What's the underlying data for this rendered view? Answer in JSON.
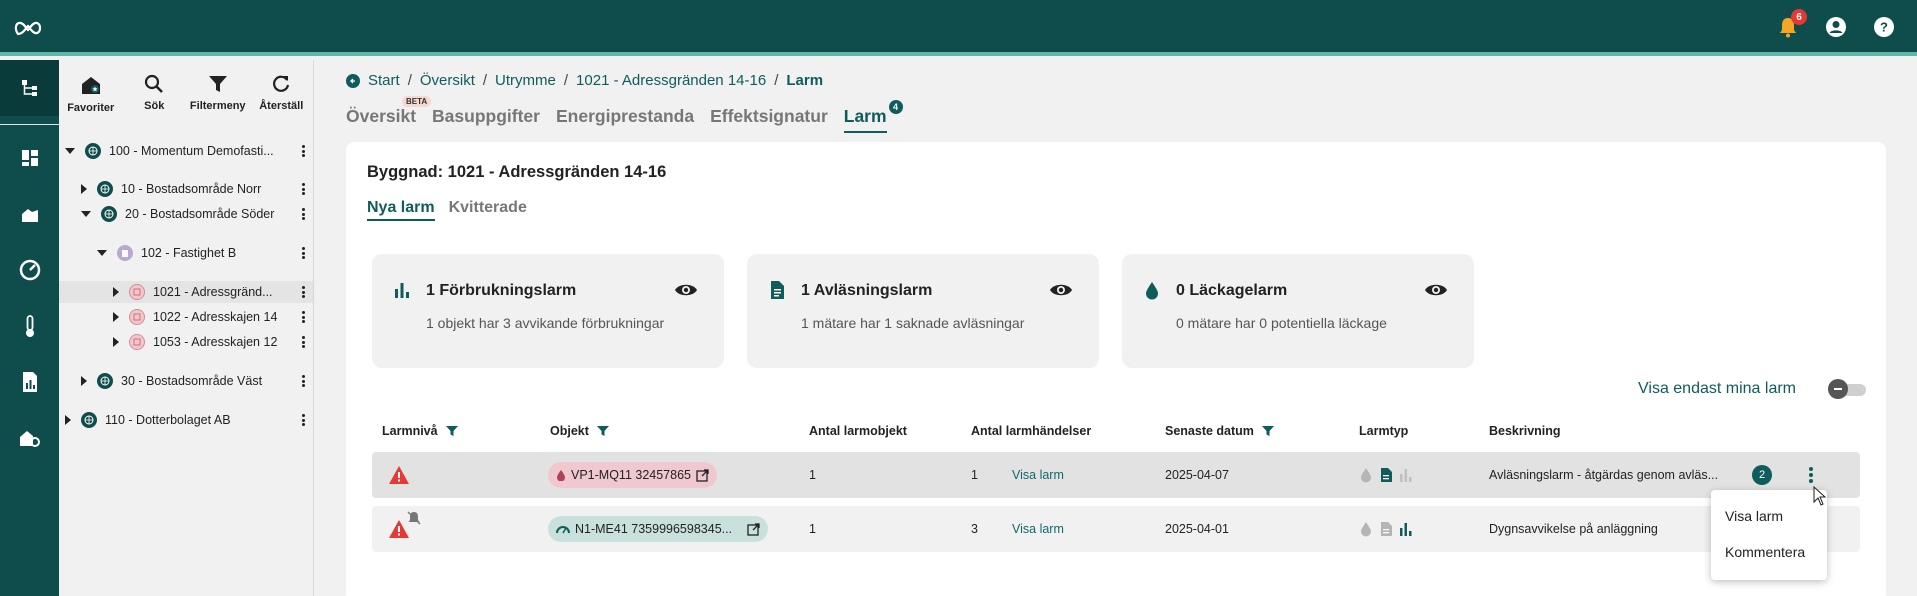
{
  "header": {
    "notification_count": "6"
  },
  "tree": {
    "tools": [
      {
        "label": "Favoriter",
        "icon": "favorite-house-icon"
      },
      {
        "label": "Sök",
        "icon": "search-icon"
      },
      {
        "label": "Filtermeny",
        "icon": "filter-icon"
      },
      {
        "label": "Återställ",
        "icon": "refresh-icon"
      }
    ],
    "nodes": [
      {
        "label": "100 - Momentum Demofasti...",
        "level": 0,
        "expanded": true,
        "type": "globe"
      },
      {
        "label": "10 - Bostadsområde Norr",
        "level": 1,
        "expanded": false,
        "type": "globe"
      },
      {
        "label": "20 - Bostadsområde Söder",
        "level": 1,
        "expanded": true,
        "type": "globe"
      },
      {
        "label": "102 - Fastighet B",
        "level": 2,
        "expanded": true,
        "type": "property"
      },
      {
        "label": "1021 - Adressgränd...",
        "level": 3,
        "expanded": false,
        "type": "building",
        "selected": true
      },
      {
        "label": "1022 - Adresskajen 14",
        "level": 3,
        "expanded": false,
        "type": "building"
      },
      {
        "label": "1053 - Adresskajen 12",
        "level": 3,
        "expanded": false,
        "type": "building"
      },
      {
        "label": "30 - Bostadsområde Väst",
        "level": 1,
        "expanded": false,
        "type": "globe"
      },
      {
        "label": "110 - Dotterbolaget AB",
        "level": 0,
        "expanded": false,
        "type": "globe"
      }
    ]
  },
  "breadcrumb": {
    "items": [
      "Start",
      "Översikt",
      "Utrymme",
      "1021 - Adressgränden 14-16"
    ],
    "current": "Larm"
  },
  "tabs": {
    "items": [
      "Översikt",
      "Basuppgifter",
      "Energiprestanda",
      "Effektsignatur",
      "Larm"
    ],
    "beta": "BETA",
    "larm_badge": "4"
  },
  "main": {
    "building_title": "Byggnad: 1021 - Adressgränden 14-16",
    "subtabs": [
      "Nya larm",
      "Kvitterade"
    ],
    "summary": [
      {
        "title": "1 Förbrukningslarm",
        "subtitle": "1 objekt har 3 avvikande förbrukningar"
      },
      {
        "title": "1 Avläsningslarm",
        "subtitle": "1 mätare har 1 saknade avläsningar"
      },
      {
        "title": "0 Läckagelarm",
        "subtitle": "0 mätare har 0 potentiella läckage"
      }
    ],
    "my_alarms_label": "Visa endast mina larm"
  },
  "table": {
    "headers": [
      "Larmnivå",
      "Objekt",
      "Antal larmobjekt",
      "Antal larmhändelser",
      "Senaste datum",
      "Larmtyp",
      "Beskrivning"
    ],
    "rows": [
      {
        "object": "VP1-MQ11 32457865",
        "objects": "1",
        "events": "1",
        "link": "Visa larm",
        "date": "2025-04-07",
        "description": "Avläsningslarm - åtgärdas genom avläs...",
        "comments": "2"
      },
      {
        "object": "N1-ME41 7359996598345...",
        "objects": "1",
        "events": "3",
        "link": "Visa larm",
        "date": "2025-04-01",
        "description": "Dygnsavvikelse på anläggning"
      }
    ]
  },
  "context_menu": {
    "items": [
      "Visa larm",
      "Kommentera"
    ]
  },
  "colors": {
    "brand": "#0f4c4c",
    "accent": "#0f5c5c",
    "alert": "#e53935"
  }
}
